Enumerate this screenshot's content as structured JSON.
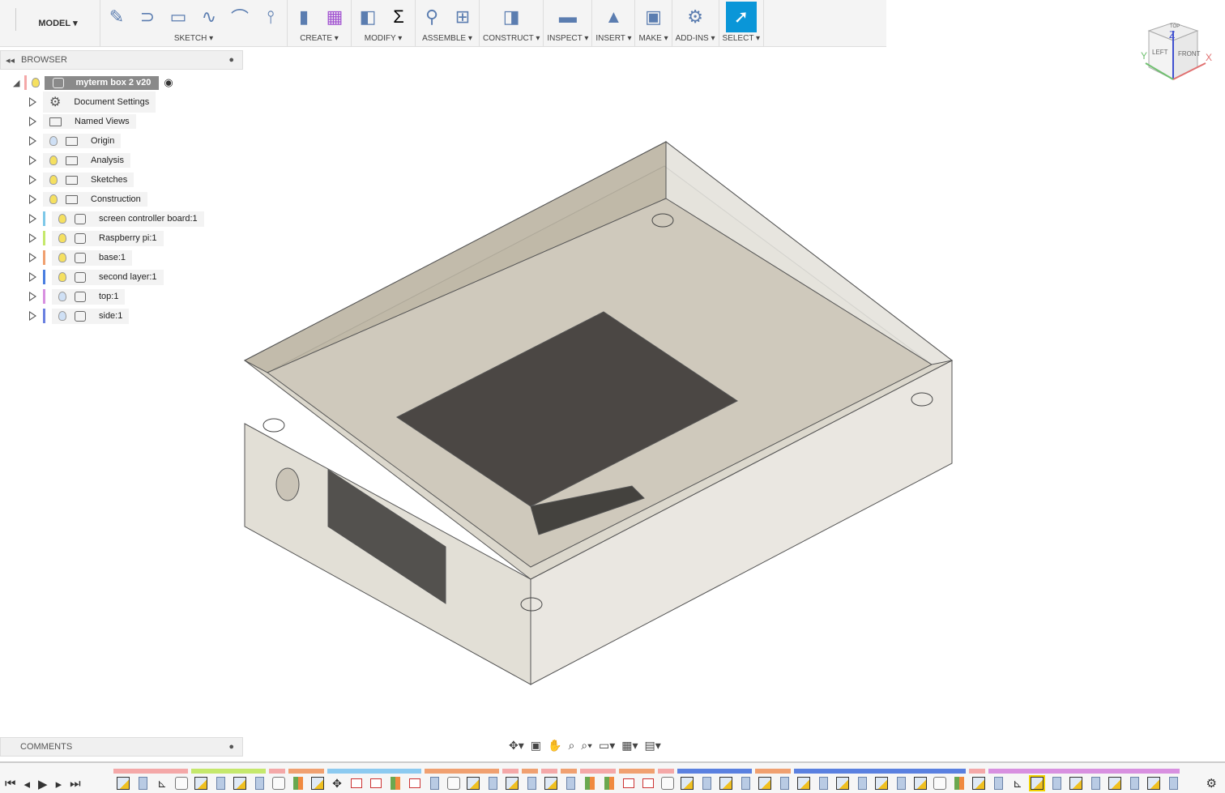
{
  "toolbar": {
    "workspace": "MODEL",
    "groups": [
      {
        "label": "SKETCH",
        "icons": [
          "create-sketch-icon",
          "line-icon",
          "rectangle-icon",
          "spline-icon",
          "fillet-icon",
          "offset-icon"
        ]
      },
      {
        "label": "CREATE",
        "icons": [
          "extrude-icon",
          "form-icon"
        ]
      },
      {
        "label": "MODIFY",
        "icons": [
          "press-pull-icon",
          "parameters-icon"
        ]
      },
      {
        "label": "ASSEMBLE",
        "icons": [
          "joint-icon",
          "new-component-icon"
        ]
      },
      {
        "label": "CONSTRUCT",
        "icons": [
          "plane-icon"
        ]
      },
      {
        "label": "INSPECT",
        "icons": [
          "measure-icon"
        ]
      },
      {
        "label": "INSERT",
        "icons": [
          "insert-image-icon"
        ]
      },
      {
        "label": "MAKE",
        "icons": [
          "3d-print-icon"
        ]
      },
      {
        "label": "ADD-INS",
        "icons": [
          "scripts-icon"
        ]
      },
      {
        "label": "SELECT",
        "icons": [
          "select-icon"
        ]
      }
    ]
  },
  "browser": {
    "title": "BROWSER",
    "root": "myterm box 2 v20",
    "items": [
      {
        "label": "Document Settings",
        "type": "settings"
      },
      {
        "label": "Named Views",
        "type": "folder"
      },
      {
        "label": "Origin",
        "type": "folder",
        "bulb": "off"
      },
      {
        "label": "Analysis",
        "type": "folder",
        "bulb": "on"
      },
      {
        "label": "Sketches",
        "type": "folder",
        "bulb": "on"
      },
      {
        "label": "Construction",
        "type": "folder",
        "bulb": "on"
      },
      {
        "label": "screen controller board:1",
        "type": "component",
        "color": "#7ec8e8",
        "bulb": "on"
      },
      {
        "label": "Raspberry pi:1",
        "type": "component",
        "color": "#c5e86c",
        "bulb": "on"
      },
      {
        "label": "base:1",
        "type": "component",
        "color": "#f0a070",
        "bulb": "on"
      },
      {
        "label": "second layer:1",
        "type": "component",
        "color": "#4a7ee0",
        "bulb": "on"
      },
      {
        "label": "top:1",
        "type": "component",
        "color": "#d890e0",
        "bulb": "off"
      },
      {
        "label": "side:1",
        "type": "component",
        "color": "#6a80e0",
        "bulb": "off"
      }
    ]
  },
  "viewcube": {
    "top": "TOP",
    "left": "LEFT",
    "front": "FRONT",
    "axes": [
      "X",
      "Y",
      "Z"
    ]
  },
  "comments": {
    "title": "COMMENTS"
  },
  "nav_icons": [
    "orbit-icon",
    "look-at-icon",
    "pan-icon",
    "zoom-icon",
    "fit-icon",
    "display-settings-icon",
    "grid-icon",
    "viewports-icon"
  ],
  "timeline": {
    "controls": [
      "go-to-start",
      "step-back",
      "play",
      "step-forward",
      "go-to-end"
    ],
    "groups": [
      {
        "color": "#f4a8a8",
        "count": 4
      },
      {
        "color": "#c5e86c",
        "count": 4
      },
      {
        "color": "#f4a8a8",
        "count": 1
      },
      {
        "color": "#f0a070",
        "count": 2
      },
      {
        "color": "#8ccaf0",
        "count": 5
      },
      {
        "color": "#f0a070",
        "count": 4
      },
      {
        "color": "#f4a8a8",
        "count": 1
      },
      {
        "color": "#f0a070",
        "count": 1
      },
      {
        "color": "#f4a8a8",
        "count": 1
      },
      {
        "color": "#f0a070",
        "count": 1
      },
      {
        "color": "#f4a8a8",
        "count": 2
      },
      {
        "color": "#f0a070",
        "count": 2
      },
      {
        "color": "#f4a8a8",
        "count": 1
      },
      {
        "color": "#5a80e0",
        "count": 4
      },
      {
        "color": "#f0a070",
        "count": 2
      },
      {
        "color": "#5a80e0",
        "count": 9
      },
      {
        "color": "#f4a8a8",
        "count": 1
      },
      {
        "color": "#d890e0",
        "count": 10
      }
    ],
    "features": [
      "sketch",
      "extrude",
      "joint-origin",
      "body",
      "sketch",
      "extrude",
      "sketch",
      "extrude",
      "body",
      "plane",
      "sketch",
      "move",
      "joint",
      "joint",
      "plane",
      "joint",
      "extrude",
      "body",
      "sketch",
      "extrude",
      "sketch",
      "extrude",
      "sketch",
      "extrude",
      "plane",
      "plane",
      "joint",
      "joint",
      "body",
      "sketch",
      "extrude",
      "sketch",
      "extrude",
      "sketch",
      "extrude",
      "sketch",
      "extrude",
      "sketch",
      "extrude",
      "sketch",
      "extrude",
      "sketch",
      "body",
      "plane",
      "sketch",
      "extrude",
      "joint-origin",
      "sketch",
      "extrude",
      "sketch",
      "extrude",
      "sketch",
      "extrude",
      "sketch",
      "extrude"
    ],
    "active_index": 47
  }
}
